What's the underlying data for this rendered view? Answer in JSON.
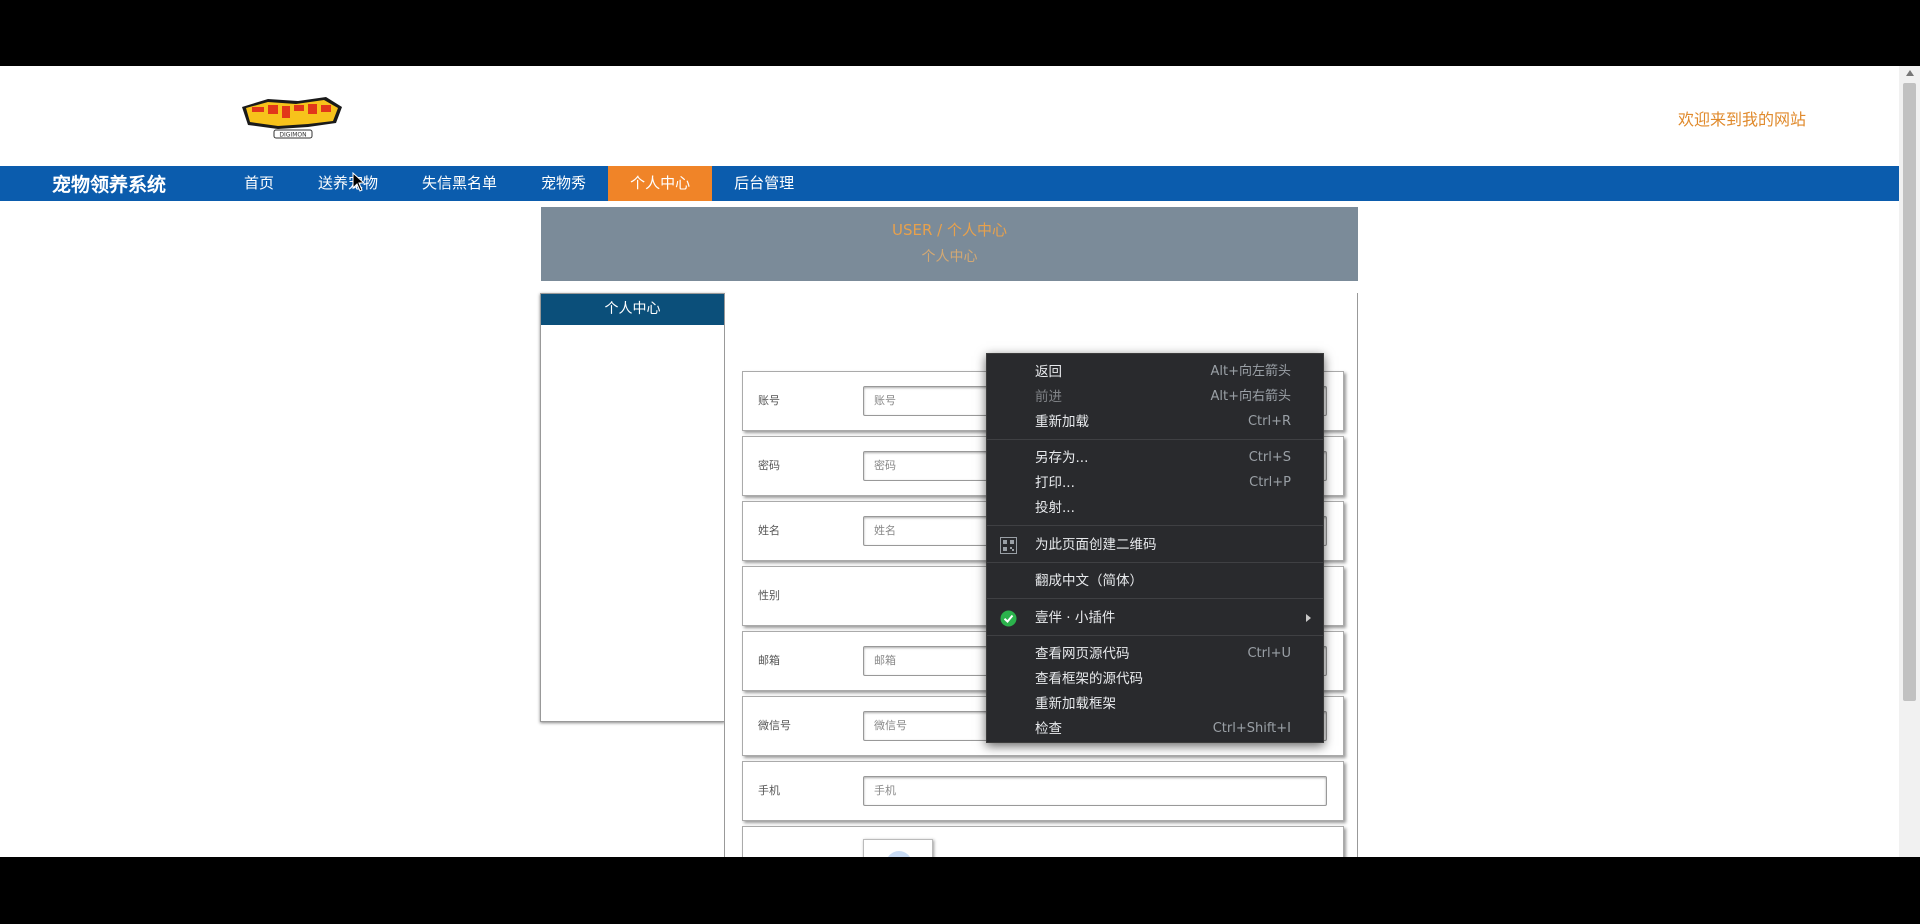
{
  "header": {
    "welcome": "欢迎来到我的网站",
    "logo_text": "DIGIMON"
  },
  "nav": {
    "brand": "宠物领养系统",
    "items": [
      {
        "label": "首页"
      },
      {
        "label": "送养宠物"
      },
      {
        "label": "失信黑名单"
      },
      {
        "label": "宠物秀"
      },
      {
        "label": "个人中心",
        "active": true
      },
      {
        "label": "后台管理"
      }
    ]
  },
  "banner": {
    "line1": "USER / 个人中心",
    "line2": "个人中心"
  },
  "sidebar": {
    "title": "个人中心"
  },
  "form": {
    "account": {
      "label": "账号",
      "placeholder": "账号"
    },
    "password": {
      "label": "密码",
      "placeholder": "密码"
    },
    "name": {
      "label": "姓名",
      "placeholder": "姓名"
    },
    "gender": {
      "label": "性别"
    },
    "email": {
      "label": "邮箱",
      "placeholder": "邮箱"
    },
    "wechat": {
      "label": "微信号",
      "placeholder": "微信号"
    },
    "phone": {
      "label": "手机",
      "placeholder": "手机"
    }
  },
  "context_menu": {
    "back": {
      "label": "返回",
      "shortcut": "Alt+向左箭头"
    },
    "forward": {
      "label": "前进",
      "shortcut": "Alt+向右箭头"
    },
    "reload": {
      "label": "重新加载",
      "shortcut": "Ctrl+R"
    },
    "save_as": {
      "label": "另存为...",
      "shortcut": "Ctrl+S"
    },
    "print": {
      "label": "打印...",
      "shortcut": "Ctrl+P"
    },
    "cast": {
      "label": "投射..."
    },
    "qr": {
      "label": "为此页面创建二维码"
    },
    "translate": {
      "label": "翻成中文（简体）"
    },
    "plugin": {
      "label": "壹伴 · 小插件"
    },
    "view_source": {
      "label": "查看网页源代码",
      "shortcut": "Ctrl+U"
    },
    "view_frame_source": {
      "label": "查看框架的源代码"
    },
    "reload_frame": {
      "label": "重新加载框架"
    },
    "inspect": {
      "label": "检查",
      "shortcut": "Ctrl+Shift+I"
    }
  },
  "colors": {
    "nav_bg": "#0b5cad",
    "nav_active": "#f08428",
    "sidebar_head": "#0b4f7a",
    "menu_bg": "#292a2d",
    "plugin_green": "#2bb24c"
  }
}
